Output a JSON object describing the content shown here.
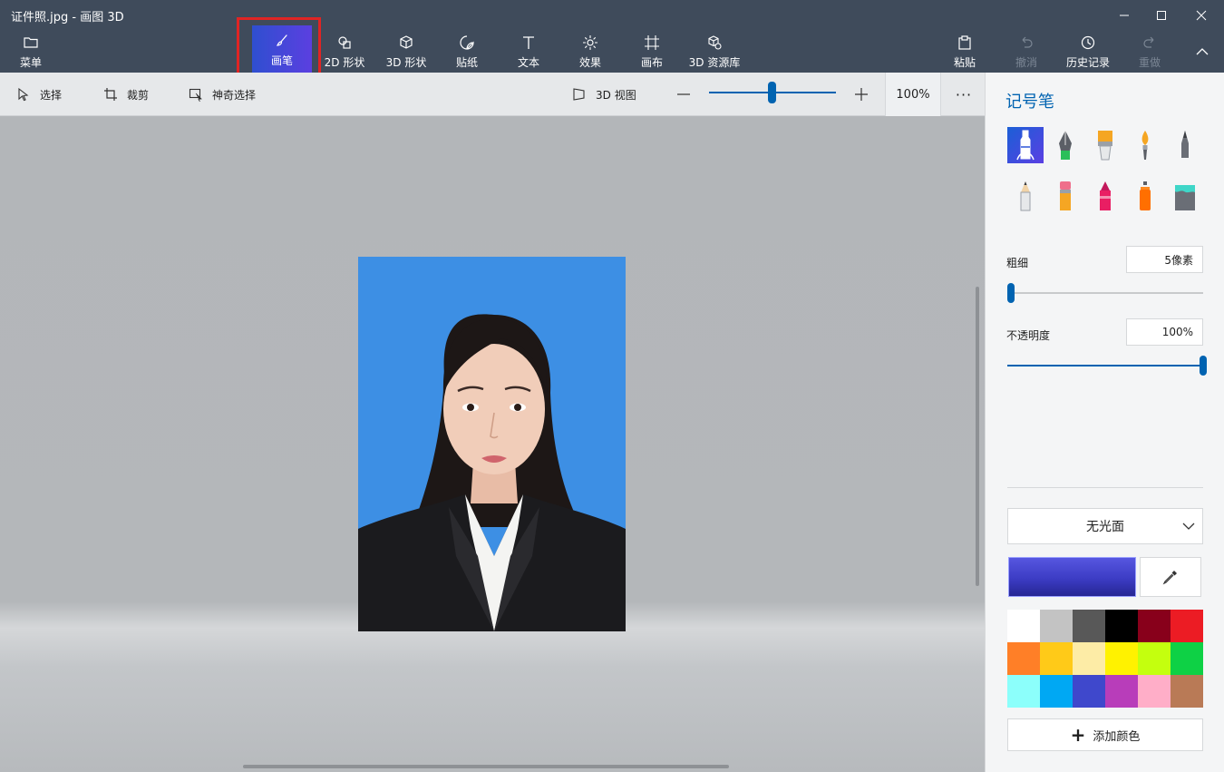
{
  "window": {
    "title": "证件照.jpg - 画图 3D",
    "controls": [
      "minimize",
      "maximize",
      "close"
    ]
  },
  "commandbar": {
    "menu": "菜单",
    "brushes": "画笔",
    "shapes2d": "2D 形状",
    "shapes3d": "3D 形状",
    "stickers": "贴纸",
    "text": "文本",
    "effects": "效果",
    "canvas": "画布",
    "library3d": "3D 资源库",
    "paste": "粘贴",
    "undo": "撤消",
    "history": "历史记录",
    "redo": "重做",
    "active": "画笔"
  },
  "subtoolbar": {
    "select": "选择",
    "crop": "裁剪",
    "magic_select": "神奇选择",
    "view3d": "3D 视图",
    "zoom_level": 0.5,
    "zoom": "100%",
    "more": "···"
  },
  "panel": {
    "title": "记号笔",
    "brushes": [
      {
        "name": "marker",
        "selected": true
      },
      {
        "name": "calligraphy-pen",
        "selected": false
      },
      {
        "name": "oil-brush",
        "selected": false
      },
      {
        "name": "watercolor",
        "selected": false
      },
      {
        "name": "pixel-pen",
        "selected": false
      },
      {
        "name": "pencil",
        "selected": false
      },
      {
        "name": "eraser",
        "selected": false
      },
      {
        "name": "crayon",
        "selected": false
      },
      {
        "name": "spray-can",
        "selected": false
      },
      {
        "name": "fill",
        "selected": false
      }
    ],
    "thickness_label": "粗细",
    "thickness_value": "5像素",
    "thickness_level": 0.02,
    "opacity_label": "不透明度",
    "opacity_value": "100%",
    "opacity_level": 1.0,
    "finish": "无光面",
    "current_color": "#3c3cc4",
    "palette": [
      "#ffffff",
      "#c3c3c3",
      "#585858",
      "#000000",
      "#88001b",
      "#ec1c24",
      "#ff7f27",
      "#ffca18",
      "#fdeca6",
      "#fff200",
      "#c4ff0e",
      "#0ed145",
      "#8cfffb",
      "#00a8f3",
      "#3f48cc",
      "#b83dba",
      "#ffaec8",
      "#b97a56"
    ],
    "add_color": "添加颜色"
  },
  "colors": {
    "accent": "#0063b1",
    "titlebar": "#3f4b5b",
    "photo_bg": "#3d8fe4",
    "highlight": "#e02424"
  }
}
